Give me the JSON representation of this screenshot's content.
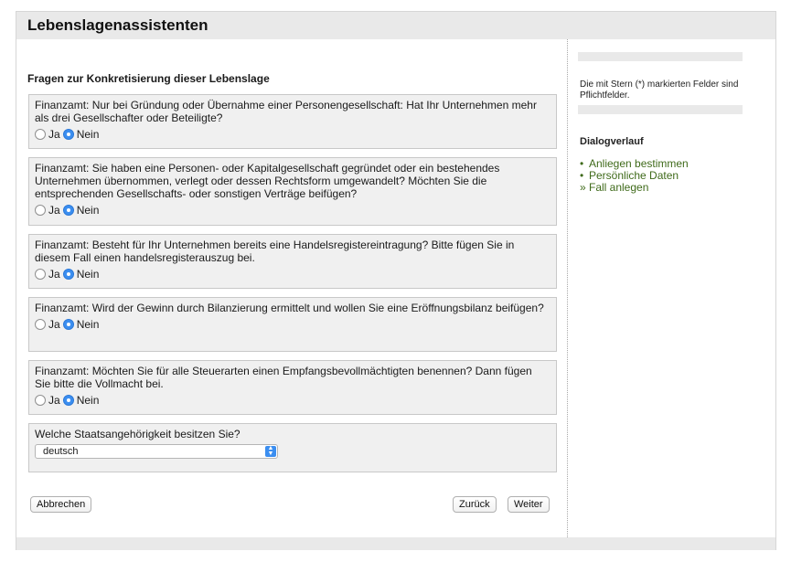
{
  "page": {
    "title": "Lebenslagenassistenten"
  },
  "main": {
    "section_title": "Fragen zur Konkretisierung dieser Lebenslage",
    "questions": [
      {
        "text": "Finanzamt: Nur bei Gründung oder Übernahme einer Personengesellschaft: Hat Ihr Unternehmen mehr als drei Gesellschafter oder Beteiligte?",
        "yes_label": "Ja",
        "no_label": "Nein",
        "selected": "Nein"
      },
      {
        "text": "Finanzamt: Sie haben eine Personen- oder Kapitalgesellschaft gegründet oder ein bestehendes Unternehmen übernommen, verlegt oder dessen Rechtsform umgewandelt? Möchten Sie die entsprechenden Gesellschafts- oder sonstigen Verträge beifügen?",
        "yes_label": "Ja",
        "no_label": "Nein",
        "selected": "Nein"
      },
      {
        "text": "Finanzamt: Besteht für Ihr Unternehmen bereits eine Handelsregistereintragung? Bitte fügen Sie in diesem Fall einen handelsregisterauszug bei.",
        "yes_label": "Ja",
        "no_label": "Nein",
        "selected": "Nein"
      },
      {
        "text": "Finanzamt: Wird der Gewinn durch Bilanzierung ermittelt und wollen Sie eine Eröffnungsbilanz beifügen?",
        "yes_label": "Ja",
        "no_label": "Nein",
        "selected": "Nein"
      },
      {
        "text": "Finanzamt: Möchten Sie für alle Steuerarten einen Empfangsbevollmächtigten benennen? Dann fügen Sie bitte die Vollmacht bei.",
        "yes_label": "Ja",
        "no_label": "Nein",
        "selected": "Nein"
      }
    ],
    "nationality": {
      "question": "Welche Staatsangehörigkeit besitzen Sie?",
      "selected": "deutsch"
    },
    "buttons": {
      "cancel": "Abbrechen",
      "back": "Zurück",
      "next": "Weiter"
    }
  },
  "sidebar": {
    "required_note": "Die mit Stern (*) markierten Felder sind Pflichtfelder.",
    "dialog_title": "Dialogverlauf",
    "dialog_items": [
      {
        "marker": "•",
        "label": "Anliegen bestimmen"
      },
      {
        "marker": "•",
        "label": "Persönliche Daten"
      },
      {
        "marker": "»",
        "label": "Fall anlegen"
      }
    ]
  },
  "colors": {
    "radio_selected": "#3b8ef0",
    "link_green": "#3f6a1a",
    "panel_gray": "#e9e9e9",
    "question_bg": "#f0f0f0"
  }
}
